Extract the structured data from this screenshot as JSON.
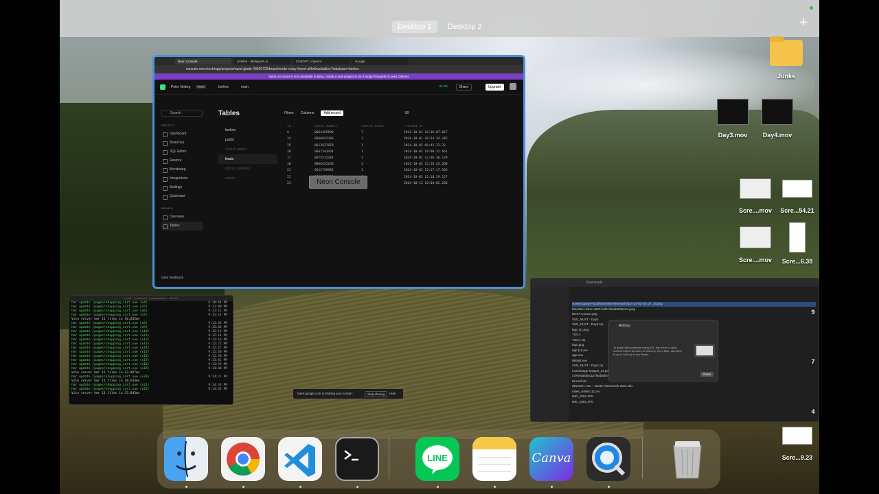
{
  "desktop": {
    "spaces": [
      "Desktop 1",
      "Desktop 2"
    ],
    "add_label": "+"
  },
  "browser": {
    "tabs": [
      "Neon Console",
      "Untitled - dbdiagram.io",
      "ChatGPT | OpenAI",
      "Google"
    ],
    "url": "console.neon.tech/app/projects/rapid-glade-49636720/branches/br-noisy-forest-a5fw5ws/tables?database=berline",
    "banner": "Neon on Azure is now available in Beta, create a new project to try it today!   Request Access   Dismiss",
    "user": "Peter Notbrg",
    "plan": "FREE",
    "database": "berline",
    "branch": "main",
    "status": "All OK",
    "share": "Share",
    "upgrade": "Upgrade"
  },
  "sidebar": {
    "search": "Search",
    "group_project": "PROJECT",
    "items": [
      "Dashboard",
      "Branches",
      "SQL Editor",
      "Restore",
      "Monitoring",
      "Integrations",
      "Settings",
      "Quickstart"
    ],
    "group_branch": "BRANCH",
    "branch_items": [
      "Overview",
      "Tables"
    ],
    "feedback": "Give feedback"
  },
  "tables": {
    "title": "Tables",
    "filters": "Filters",
    "columns": "Columns",
    "add_record": "Add record",
    "pager": "50",
    "schema_db": "berline",
    "schema": "public",
    "search_tables": "Search tables...",
    "list": [
      "leads",
      "phone_numbers",
      "orders"
    ],
    "headers": [
      "id",
      "phone_number",
      "search_count",
      "created_at"
    ],
    "rows": [
      [
        "9",
        "0864392899",
        "7",
        "2024-10-01 16:16:07.017"
      ],
      [
        "14",
        "0860942346",
        "1",
        "2024-10-01 16:34:34.342"
      ],
      [
        "15",
        "0612927878",
        "1",
        "2024-10-02 06:45:33.32"
      ],
      [
        "16",
        "0667343434",
        "1",
        "2024-10-02 10:08:32.661"
      ],
      [
        "17",
        "0675512344",
        "1",
        "2024-10-02 12:06:36.129"
      ],
      [
        "18",
        "0866432146",
        "2",
        "2024-10-02 12:56:45.268"
      ],
      [
        "21",
        "0612799983",
        "1",
        "2024-10-02 12:17:17.505"
      ],
      [
        "22",
        "0830070983",
        "1",
        "2024-10-02 12:18:29.127"
      ],
      [
        "23",
        "0664398987",
        "1",
        "2024-10-12 12:04:02.106"
      ]
    ],
    "tooltip": "Neon Console"
  },
  "terminal": {
    "title": "nuxt3 — nodemon ~/projects/nuxt — 80×24",
    "lines": [
      {
        "text": "hmr update /pages/shopping_cart.vue (x4)",
        "time": "9:10:44 PM"
      },
      {
        "text": "hmr update /pages/shopping_cart.vue (x5)",
        "time": "9:11:08 PM"
      },
      {
        "text": "hmr update /pages/shopping_cart.vue (x6)",
        "time": "9:11:11 PM"
      },
      {
        "text": "hmr update /pages/shopping_cart.vue (x7)",
        "time": "9:11:14 PM"
      },
      {
        "text": "Vite server hmr 11 files in 36.632ms",
        "time": ""
      },
      {
        "text": "hmr update /pages/shopping_cart.vue (x8)",
        "time": "9:11:46 PM"
      },
      {
        "text": "hmr update /pages/shopping_cart.vue (x9)",
        "time": "9:12:06 PM"
      },
      {
        "text": "hmr update /pages/shopping_cart.vue (x10)",
        "time": "9:12:12 PM"
      },
      {
        "text": "hmr update /pages/shopping_cart.vue (x11)",
        "time": "9:12:14 PM"
      },
      {
        "text": "hmr update /pages/shopping_cart.vue (x12)",
        "time": "9:12:16 PM"
      },
      {
        "text": "hmr update /pages/shopping_cart.vue (x13)",
        "time": "9:12:22 PM"
      },
      {
        "text": "hmr update /pages/shopping_cart.vue (x14)",
        "time": "9:12:27 PM"
      },
      {
        "text": "hmr update /pages/shopping_cart.vue (x15)",
        "time": "9:12:30 PM"
      },
      {
        "text": "hmr update /pages/shopping_cart.vue (x16)",
        "time": "9:12:38 PM"
      },
      {
        "text": "hmr update /pages/shopping_cart.vue (x17)",
        "time": "9:13:42 PM"
      },
      {
        "text": "hmr update /pages/shopping_cart.vue (x18)",
        "time": "9:13:59 PM"
      },
      {
        "text": "hmr update /pages/shopping_cart.vue (x19)",
        "time": "9:14:08 PM"
      },
      {
        "text": "Vite server hmr 11 files in 33.897ms",
        "time": ""
      },
      {
        "text": "hmr update /pages/shopping_cart.vue (x20)",
        "time": "9:14:21 PM"
      },
      {
        "text": "Vite server hmr 11 files in 28.634ms",
        "time": ""
      },
      {
        "text": "hmr update /pages/shopping_cart.vue (x21)",
        "time": "9:14:33 PM"
      },
      {
        "text": "hmr update /pages/shopping_cart.vue (x22)",
        "time": "9:14:35 PM"
      },
      {
        "text": "Vite server hmr 11 files in 33.843ms",
        "time": ""
      }
    ]
  },
  "sharing": {
    "text": "meet.google.com is sharing your screen.",
    "stop": "Stop sharing",
    "hide": "Hide"
  },
  "finder": {
    "title": "Downloads",
    "files": [
      "screencapture-localhost-3000-terminal-2024-10-02-19_07_34.png",
      "f8ae28e1-9d4c-4629-b4f5-0baab98fae04.jpeg",
      "NUXT Course.png",
      "VUE_NUXT - Day3",
      "VUE_NUXT - Day3.zip",
      "logo (1).png",
      "TOCA",
      "TOCA.zip",
      "logo.png",
      "app (1).vue",
      "app.vue",
      "default.vue",
      "VUE_NUXT - Day2.zip",
      "coverimage-snippet_24.png",
      "c7e6e5a6d5c1a7f6ab8d87e8c30c...8d.docx",
      "Unconf.xls",
      "aDevDev Vue + Nuxt3 Framework 2024.xlsx",
      "sales_orders (1).csv",
      "IMG_3303.JPG",
      "IMG_3301.JPG"
    ],
    "airdrop": {
      "title": "AirDrop",
      "body": "To share with someone using iOS, ask them to open Control Centre and turn on AirDrop. On a Mac, ask them to go to AirDrop in the Finder.",
      "done": "Done"
    }
  },
  "desktop_icons": [
    {
      "label": "Junks"
    },
    {
      "label": "Day3.mov"
    },
    {
      "label": "Day4.mov"
    },
    {
      "label": "Scre....mov"
    },
    {
      "label": "Scre...54.21"
    },
    {
      "label": "Scre....mov"
    },
    {
      "label": "Scre...6.38"
    },
    {
      "label": "Scre...9.23"
    }
  ],
  "edge_digits": [
    "9",
    "7",
    "4"
  ],
  "dock": {
    "apps": [
      "Finder",
      "Google Chrome",
      "Visual Studio Code",
      "Terminal",
      "LINE",
      "Notes",
      "Canva",
      "QuickTime Player",
      "Trash"
    ],
    "line_label": "LINE",
    "canva_label": "Canva"
  },
  "colors": {
    "accent_blue": "#4e8fdc",
    "neon_green": "#38e08a",
    "banner_purple": "#7b3fc4"
  }
}
